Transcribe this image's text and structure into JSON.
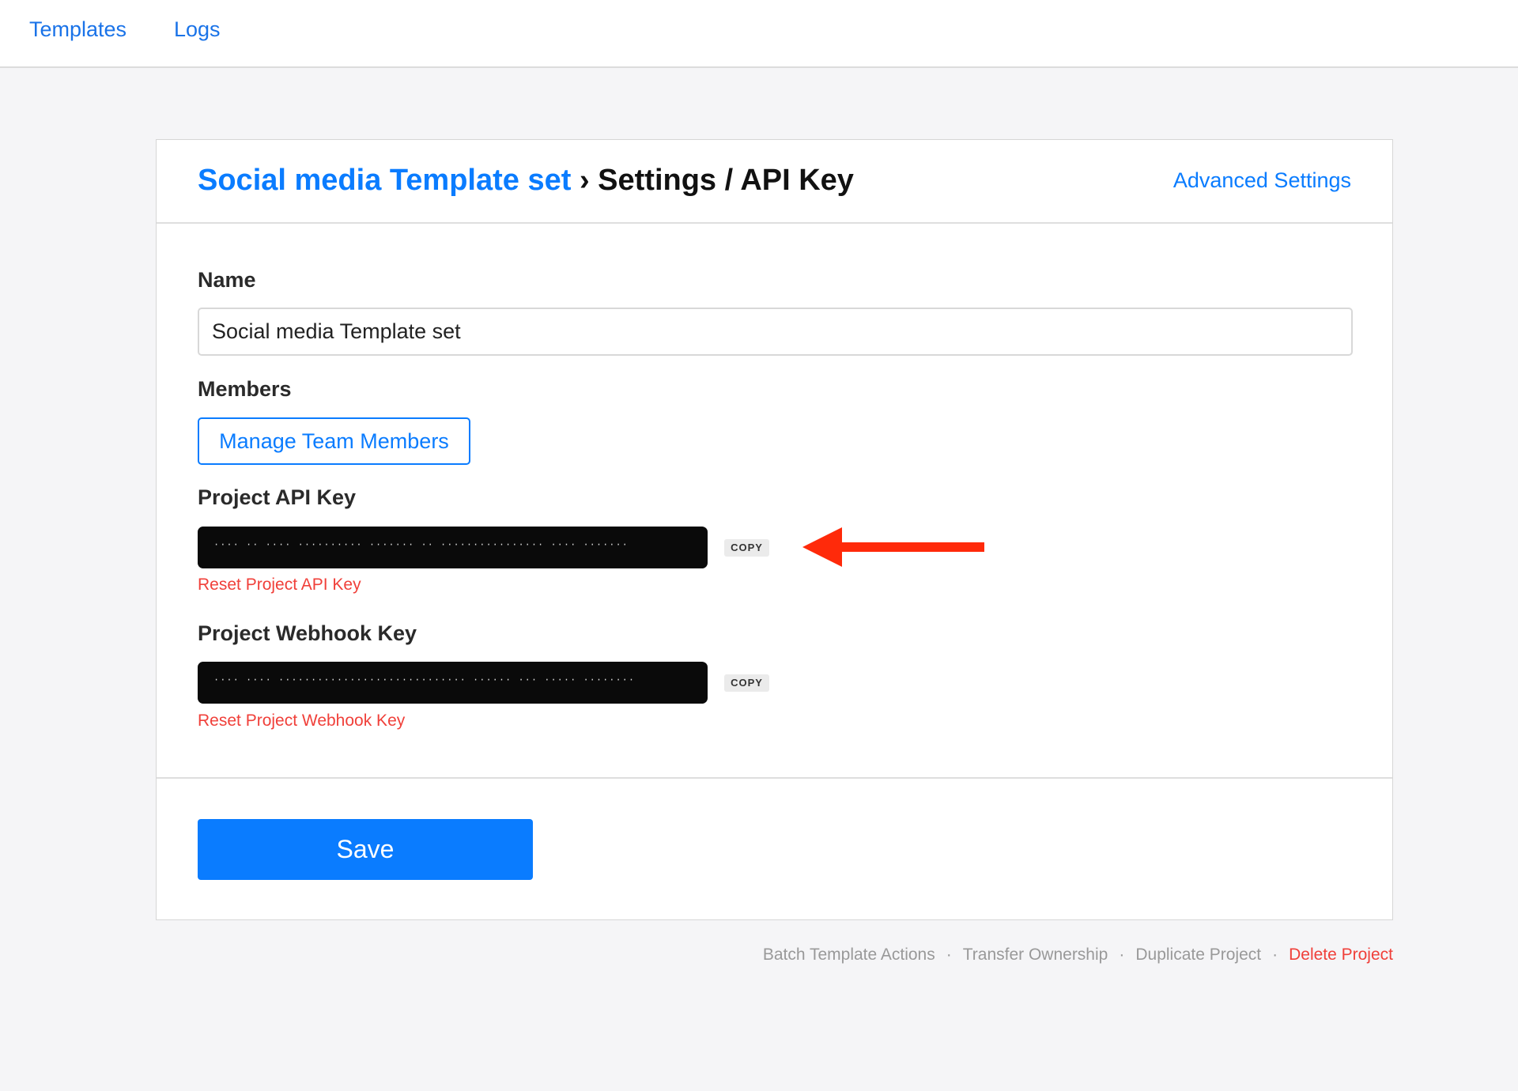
{
  "nav": {
    "items": [
      {
        "label": "Templates"
      },
      {
        "label": "Logs"
      }
    ]
  },
  "header": {
    "breadcrumb": "Social media Template set",
    "separator": "›",
    "title": "Settings / API Key",
    "advanced": "Advanced Settings"
  },
  "form": {
    "name_label": "Name",
    "name_value": "Social media Template set",
    "members_label": "Members",
    "manage_button": "Manage Team Members",
    "api_key_label": "Project API Key",
    "api_key_value": "···· ·· ···· ·········· ······· ·· ················ ···· ·······",
    "copy_label": "COPY",
    "reset_api": "Reset Project API Key",
    "webhook_label": "Project Webhook Key",
    "webhook_value": "···· ···· ····························· ······ ··· ····· ········",
    "reset_webhook": "Reset Project Webhook Key",
    "save": "Save"
  },
  "annotation": {
    "arrow_color": "#ff2a0a"
  },
  "footer": {
    "links": [
      "Batch Template Actions",
      "Transfer Ownership",
      "Duplicate Project"
    ],
    "delete": "Delete Project",
    "separator": "·"
  }
}
